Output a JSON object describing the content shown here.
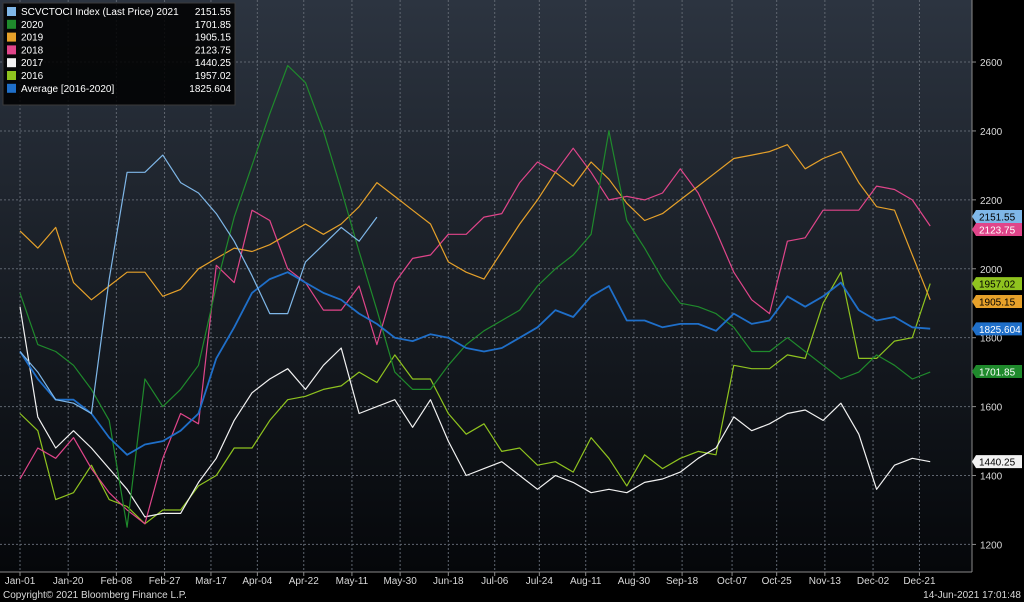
{
  "chart_data": {
    "type": "line",
    "ylim": [
      1120,
      2780
    ],
    "yticks": [
      1200,
      1400,
      1600,
      1800,
      2000,
      2200,
      2400,
      2600
    ],
    "xlim": [
      0,
      52
    ],
    "xticks": [
      {
        "label": "Jan-01",
        "x": 0
      },
      {
        "label": "Jan-20",
        "x": 2.7
      },
      {
        "label": "Feb-08",
        "x": 5.4
      },
      {
        "label": "Feb-27",
        "x": 8.1
      },
      {
        "label": "Mar-17",
        "x": 10.7
      },
      {
        "label": "Apr-04",
        "x": 13.3
      },
      {
        "label": "Apr-22",
        "x": 15.9
      },
      {
        "label": "May-11",
        "x": 18.6
      },
      {
        "label": "May-30",
        "x": 21.3
      },
      {
        "label": "Jun-18",
        "x": 24.0
      },
      {
        "label": "Jul-06",
        "x": 26.6
      },
      {
        "label": "Jul-24",
        "x": 29.1
      },
      {
        "label": "Aug-11",
        "x": 31.7
      },
      {
        "label": "Aug-30",
        "x": 34.4
      },
      {
        "label": "Sep-18",
        "x": 37.1
      },
      {
        "label": "Oct-07",
        "x": 39.9
      },
      {
        "label": "Oct-25",
        "x": 42.4
      },
      {
        "label": "Nov-13",
        "x": 45.1
      },
      {
        "label": "Dec-02",
        "x": 47.8
      },
      {
        "label": "Dec-21",
        "x": 50.4
      }
    ],
    "grid": true,
    "legend_position": "top-left",
    "series": [
      {
        "name": "SCVCTOCI Index (Last Price) 2021",
        "last": "2151.55",
        "color": "#7fb7e8",
        "values": [
          1760,
          1700,
          1620,
          1610,
          1580,
          1970,
          2280,
          2280,
          2330,
          2250,
          2220,
          2160,
          2080,
          1980,
          1870,
          1870,
          2020,
          2070,
          2120,
          2080,
          2150
        ]
      },
      {
        "name": "2020",
        "last": "1701.85",
        "color": "#1f8a2c",
        "values": [
          1930,
          1780,
          1760,
          1720,
          1650,
          1560,
          1250,
          1680,
          1600,
          1650,
          1720,
          1950,
          2150,
          2300,
          2450,
          2590,
          2540,
          2400,
          2230,
          2050,
          1880,
          1700,
          1650,
          1650,
          1720,
          1780,
          1820,
          1850,
          1880,
          1950,
          2000,
          2040,
          2100,
          2400,
          2140,
          2060,
          1970,
          1900,
          1890,
          1870,
          1830,
          1760,
          1760,
          1800,
          1760,
          1720,
          1680,
          1700,
          1750,
          1720,
          1680,
          1700
        ]
      },
      {
        "name": "2019",
        "last": "1905.15",
        "color": "#e6a12a",
        "values": [
          2110,
          2060,
          2120,
          1960,
          1910,
          1950,
          1990,
          1990,
          1920,
          1940,
          2000,
          2030,
          2060,
          2050,
          2070,
          2100,
          2130,
          2100,
          2130,
          2180,
          2250,
          2210,
          2170,
          2130,
          2020,
          1990,
          1970,
          2050,
          2130,
          2200,
          2280,
          2240,
          2310,
          2260,
          2190,
          2140,
          2160,
          2200,
          2240,
          2280,
          2320,
          2330,
          2340,
          2360,
          2290,
          2320,
          2340,
          2250,
          2180,
          2170,
          2040,
          1910
        ]
      },
      {
        "name": "2018",
        "last": "2123.75",
        "color": "#e0458a",
        "values": [
          1390,
          1480,
          1450,
          1510,
          1420,
          1350,
          1300,
          1260,
          1450,
          1580,
          1550,
          2010,
          1960,
          2170,
          2140,
          2000,
          1960,
          1880,
          1880,
          1950,
          1780,
          1960,
          2030,
          2040,
          2100,
          2100,
          2150,
          2160,
          2250,
          2310,
          2280,
          2350,
          2280,
          2200,
          2210,
          2200,
          2220,
          2290,
          2220,
          2110,
          1990,
          1910,
          1870,
          2080,
          2090,
          2170,
          2170,
          2170,
          2240,
          2230,
          2200,
          2124
        ]
      },
      {
        "name": "2017",
        "last": "1440.25",
        "color": "#f2f2f2",
        "values": [
          1890,
          1570,
          1480,
          1530,
          1480,
          1420,
          1360,
          1280,
          1290,
          1290,
          1380,
          1450,
          1560,
          1640,
          1680,
          1710,
          1650,
          1720,
          1770,
          1580,
          1600,
          1620,
          1540,
          1620,
          1500,
          1400,
          1420,
          1440,
          1400,
          1360,
          1400,
          1380,
          1350,
          1360,
          1350,
          1380,
          1390,
          1410,
          1450,
          1480,
          1570,
          1530,
          1550,
          1580,
          1590,
          1560,
          1610,
          1520,
          1360,
          1430,
          1450,
          1440
        ]
      },
      {
        "name": "2016",
        "last": "1957.02",
        "color": "#8fc31f",
        "values": [
          1580,
          1530,
          1330,
          1350,
          1430,
          1330,
          1310,
          1260,
          1300,
          1300,
          1370,
          1400,
          1480,
          1480,
          1560,
          1620,
          1630,
          1650,
          1660,
          1700,
          1670,
          1750,
          1680,
          1680,
          1580,
          1520,
          1550,
          1470,
          1480,
          1430,
          1440,
          1410,
          1510,
          1450,
          1370,
          1460,
          1420,
          1450,
          1470,
          1460,
          1720,
          1710,
          1710,
          1750,
          1740,
          1900,
          1990,
          1740,
          1740,
          1790,
          1800,
          1957
        ]
      },
      {
        "name": "Average  [2016-2020]",
        "last": "1825.604",
        "color": "#1f6fc9",
        "values": [
          1760,
          1680,
          1620,
          1620,
          1580,
          1510,
          1460,
          1490,
          1500,
          1530,
          1580,
          1740,
          1830,
          1930,
          1970,
          1990,
          1960,
          1930,
          1910,
          1870,
          1840,
          1800,
          1790,
          1810,
          1800,
          1770,
          1760,
          1770,
          1800,
          1830,
          1880,
          1860,
          1920,
          1950,
          1850,
          1850,
          1830,
          1840,
          1840,
          1820,
          1870,
          1840,
          1850,
          1920,
          1890,
          1920,
          1960,
          1880,
          1850,
          1860,
          1830,
          1826
        ]
      }
    ]
  },
  "footer": {
    "copyright": "Copyright© 2021 Bloomberg Finance L.P.",
    "timestamp": "14-Jun-2021 17:01:48"
  }
}
